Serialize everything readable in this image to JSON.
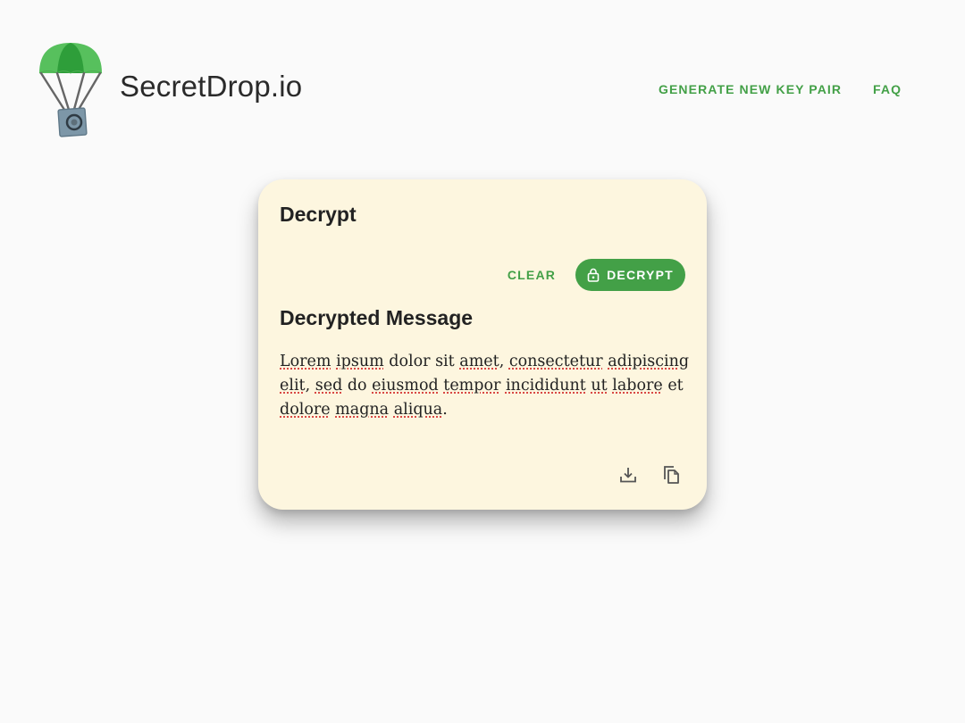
{
  "header": {
    "brand": "SecretDrop.io",
    "nav": {
      "generate_label": "GENERATE NEW KEY PAIR",
      "faq_label": "FAQ"
    }
  },
  "card": {
    "title": "Decrypt",
    "clear_label": "CLEAR",
    "decrypt_label": "DECRYPT",
    "section_title": "Decrypted Message",
    "message_words": [
      {
        "t": "Lorem",
        "sp": true
      },
      {
        "t": " ",
        "sp": false
      },
      {
        "t": "ipsum",
        "sp": true
      },
      {
        "t": " dolor sit ",
        "sp": false
      },
      {
        "t": "amet",
        "sp": true
      },
      {
        "t": ", ",
        "sp": false
      },
      {
        "t": "consectetur",
        "sp": true
      },
      {
        "t": " ",
        "sp": false
      },
      {
        "t": "adipiscing",
        "sp": true
      },
      {
        "t": " ",
        "sp": false
      },
      {
        "t": "elit",
        "sp": true
      },
      {
        "t": ", ",
        "sp": false
      },
      {
        "t": "sed",
        "sp": true
      },
      {
        "t": " do ",
        "sp": false
      },
      {
        "t": "eiusmod",
        "sp": true
      },
      {
        "t": " ",
        "sp": false
      },
      {
        "t": "tempor",
        "sp": true
      },
      {
        "t": " ",
        "sp": false
      },
      {
        "t": "incididunt",
        "sp": true
      },
      {
        "t": " ",
        "sp": false
      },
      {
        "t": "ut",
        "sp": true
      },
      {
        "t": " ",
        "sp": false
      },
      {
        "t": "labore",
        "sp": true
      },
      {
        "t": " et ",
        "sp": false
      },
      {
        "t": "dolore",
        "sp": true
      },
      {
        "t": " ",
        "sp": false
      },
      {
        "t": "magna",
        "sp": true
      },
      {
        "t": " ",
        "sp": false
      },
      {
        "t": "aliqua",
        "sp": true
      },
      {
        "t": ".",
        "sp": false
      }
    ]
  },
  "icons": {
    "logo": "parachute-safe-icon",
    "decrypt": "lock-icon",
    "download": "download-icon",
    "copy": "copy-icon"
  },
  "colors": {
    "accent": "#43a047",
    "card_bg": "#fdf6df",
    "page_bg": "#fafafa",
    "spell_underline": "#d32f2f"
  }
}
